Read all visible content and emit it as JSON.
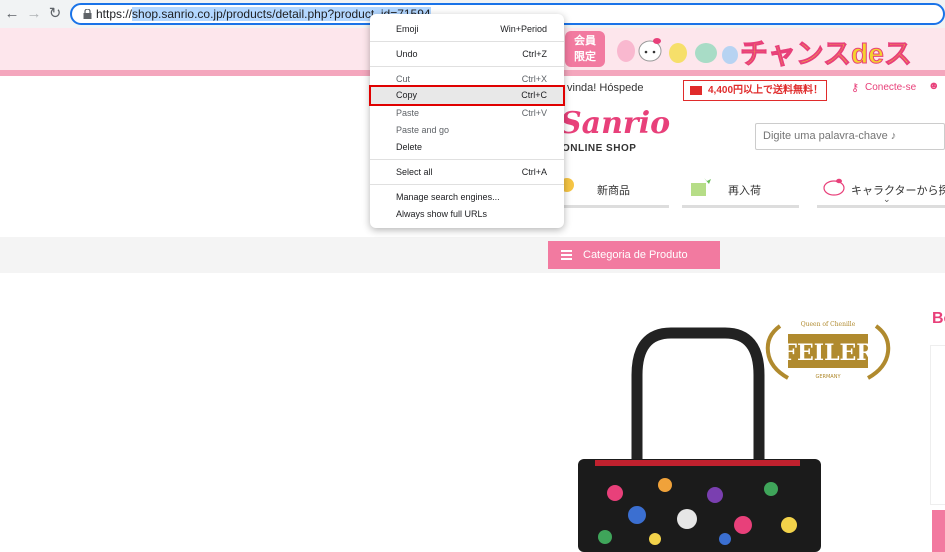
{
  "browser": {
    "url_prefix": "https://",
    "url_selected": "shop.sanrio.co.jp/products/detail.php?product_id=71594"
  },
  "site": {
    "banner": {
      "badge": "会員\n限定",
      "slogan": "チャンスdeス"
    },
    "welcome": "vinda! Hóspede",
    "shipping": "4,400円以上で送料無料！",
    "login": "Conecte-se",
    "logo": "Sanrio",
    "logo_sub": "ONLINE SHOP",
    "search_placeholder": "Digite uma palavra-chave ♪",
    "nav": [
      {
        "label": "新商品"
      },
      {
        "label": "再入荷"
      },
      {
        "label": "キャラクターから探す"
      }
    ],
    "category_button": "Categoria de Produto",
    "side_heading": "Bo",
    "brand": {
      "top": "Queen of Chenille",
      "name": "FEILER",
      "bottom": "GERMANY"
    }
  },
  "menu": {
    "items": [
      {
        "label": "Emoji",
        "shortcut": "Win+Period",
        "disabled": false
      },
      {
        "label": "Undo",
        "shortcut": "Ctrl+Z",
        "disabled": false
      },
      {
        "label": "Cut",
        "shortcut": "Ctrl+X",
        "disabled": true
      },
      {
        "label": "Copy",
        "shortcut": "Ctrl+C",
        "disabled": false
      },
      {
        "label": "Paste",
        "shortcut": "Ctrl+V",
        "disabled": true
      },
      {
        "label": "Paste and go",
        "shortcut": "",
        "disabled": true
      },
      {
        "label": "Delete",
        "shortcut": "",
        "disabled": false
      },
      {
        "label": "Select all",
        "shortcut": "Ctrl+A",
        "disabled": false
      },
      {
        "label": "Manage search engines...",
        "shortcut": "",
        "disabled": false
      },
      {
        "label": "Always show full URLs",
        "shortcut": "",
        "disabled": false
      }
    ]
  },
  "colors": {
    "accent_pink": "#f27aa0",
    "highlight_outline": "#e00000",
    "omnibox_focus": "#1a73e8"
  }
}
